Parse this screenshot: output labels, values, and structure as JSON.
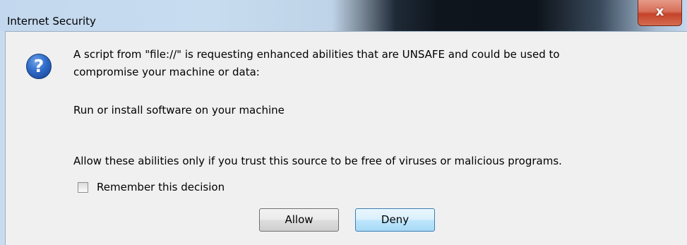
{
  "window": {
    "title": "Internet Security",
    "close_glyph": "x"
  },
  "icon": {
    "name": "question-icon",
    "glyph": "?",
    "color": "#2f6bc9"
  },
  "message": {
    "line1": "A script from \"file://\" is requesting enhanced abilities that are UNSAFE and could be used to",
    "line2": "compromise your machine or data:",
    "ability": "Run or install software on your machine",
    "warning": "Allow these abilities only if you trust this source to be free of viruses or malicious programs."
  },
  "remember": {
    "label": "Remember this decision",
    "checked": false
  },
  "buttons": {
    "allow": "Allow",
    "deny": "Deny"
  }
}
